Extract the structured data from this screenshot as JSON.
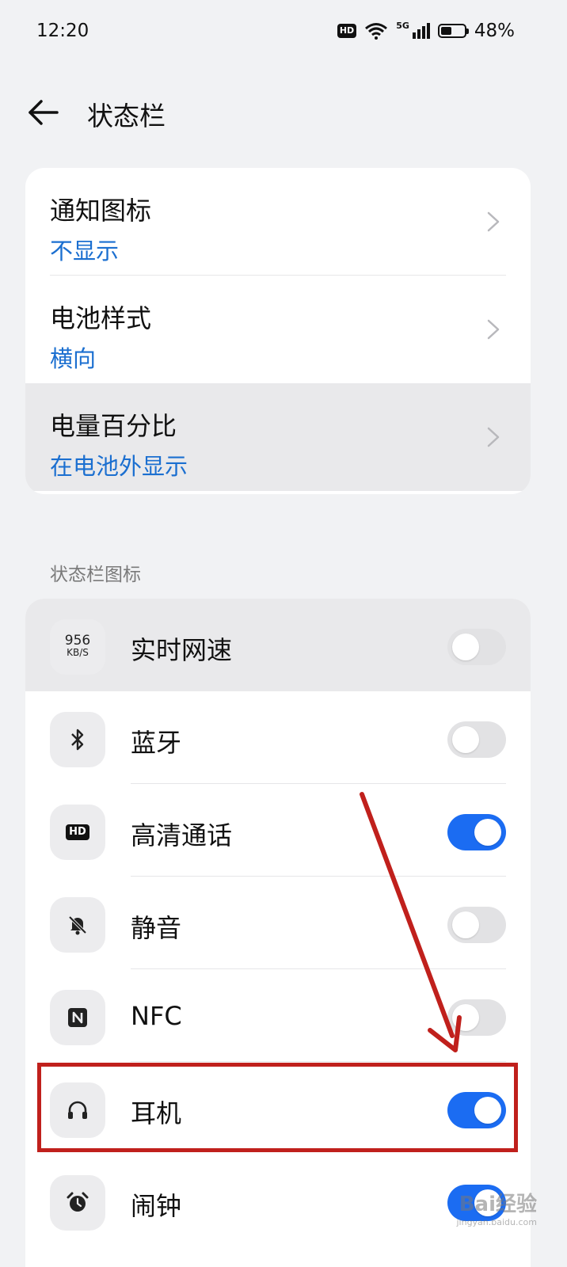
{
  "status_bar": {
    "time": "12:20",
    "hd_badge": "HD",
    "network": "5G",
    "battery_percent": "48%",
    "battery_level": 0.48
  },
  "header": {
    "title": "状态栏"
  },
  "settings": [
    {
      "label": "通知图标",
      "value": "不显示"
    },
    {
      "label": "电池样式",
      "value": "横向"
    },
    {
      "label": "电量百分比",
      "value": "在电池外显示"
    }
  ],
  "section_title": "状态栏图标",
  "icon_items": [
    {
      "label": "实时网速",
      "icon": "network-speed-icon",
      "icon_num": "956",
      "icon_unit": "KB/S",
      "enabled": false
    },
    {
      "label": "蓝牙",
      "icon": "bluetooth-icon",
      "enabled": false
    },
    {
      "label": "高清通话",
      "icon": "hd-call-icon",
      "icon_text": "HD",
      "enabled": true
    },
    {
      "label": "静音",
      "icon": "mute-bell-icon",
      "enabled": false
    },
    {
      "label": "NFC",
      "icon": "nfc-icon",
      "enabled": false
    },
    {
      "label": "耳机",
      "icon": "headphones-icon",
      "enabled": true
    },
    {
      "label": "闹钟",
      "icon": "alarm-clock-icon",
      "enabled": true
    }
  ],
  "colors": {
    "accent": "#1b6cf2",
    "value_text": "#1b6fd0",
    "annotation": "#c0201c"
  },
  "watermark": {
    "text": "Bai经验",
    "sub": "jingyan.baidu.com"
  }
}
